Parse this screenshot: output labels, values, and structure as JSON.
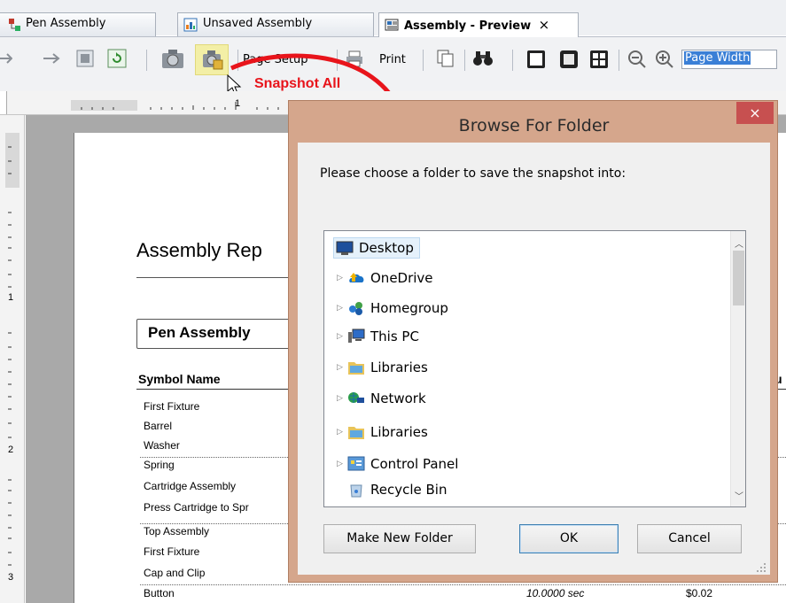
{
  "tabs": [
    {
      "label": "Pen Assembly"
    },
    {
      "label": "Unsaved Assembly"
    },
    {
      "label": "Assembly - Preview",
      "close": "×"
    }
  ],
  "toolbar": {
    "page_setup": "Page Setup",
    "print": "Print",
    "zoom_value": "Page Width"
  },
  "annotation": {
    "text": "Snapshot All",
    "color": "#e8141b"
  },
  "ruler": {
    "h": [
      "1"
    ],
    "v": [
      "1",
      "2",
      "3"
    ]
  },
  "report": {
    "title": "Assembly Rep",
    "group": "Pen Assembly",
    "column": "Symbol Name",
    "rows": [
      "First Fixture",
      "Barrel",
      "Washer",
      "Spring",
      "Cartridge Assembly",
      "Press Cartridge to Spr",
      "Top Assembly",
      "First Fixture",
      "Cap and Clip",
      "Button"
    ],
    "last_time": "10.0000 sec",
    "last_cost": "$0.02",
    "cut_col": "u"
  },
  "dialog": {
    "title": "Browse For Folder",
    "close": "×",
    "prompt": "Please choose a folder to save the snapshot into:",
    "items": [
      {
        "label": "Desktop",
        "icon": "desktop-icon"
      },
      {
        "label": "OneDrive",
        "icon": "onedrive-icon"
      },
      {
        "label": "Homegroup",
        "icon": "homegroup-icon"
      },
      {
        "label": "This PC",
        "icon": "computer-icon"
      },
      {
        "label": "Libraries",
        "icon": "libraries-icon"
      },
      {
        "label": "Network",
        "icon": "network-icon"
      },
      {
        "label": "Libraries",
        "icon": "libraries-icon"
      },
      {
        "label": "Control Panel",
        "icon": "control-panel-icon"
      },
      {
        "label": "Recycle Bin",
        "icon": "recycle-bin-icon"
      }
    ],
    "make_folder": "Make New Folder",
    "ok": "OK",
    "cancel": "Cancel"
  },
  "colors": {
    "dialog_frame": "#d5a68c",
    "close": "#c75050",
    "selection": "#3a7fd6"
  }
}
